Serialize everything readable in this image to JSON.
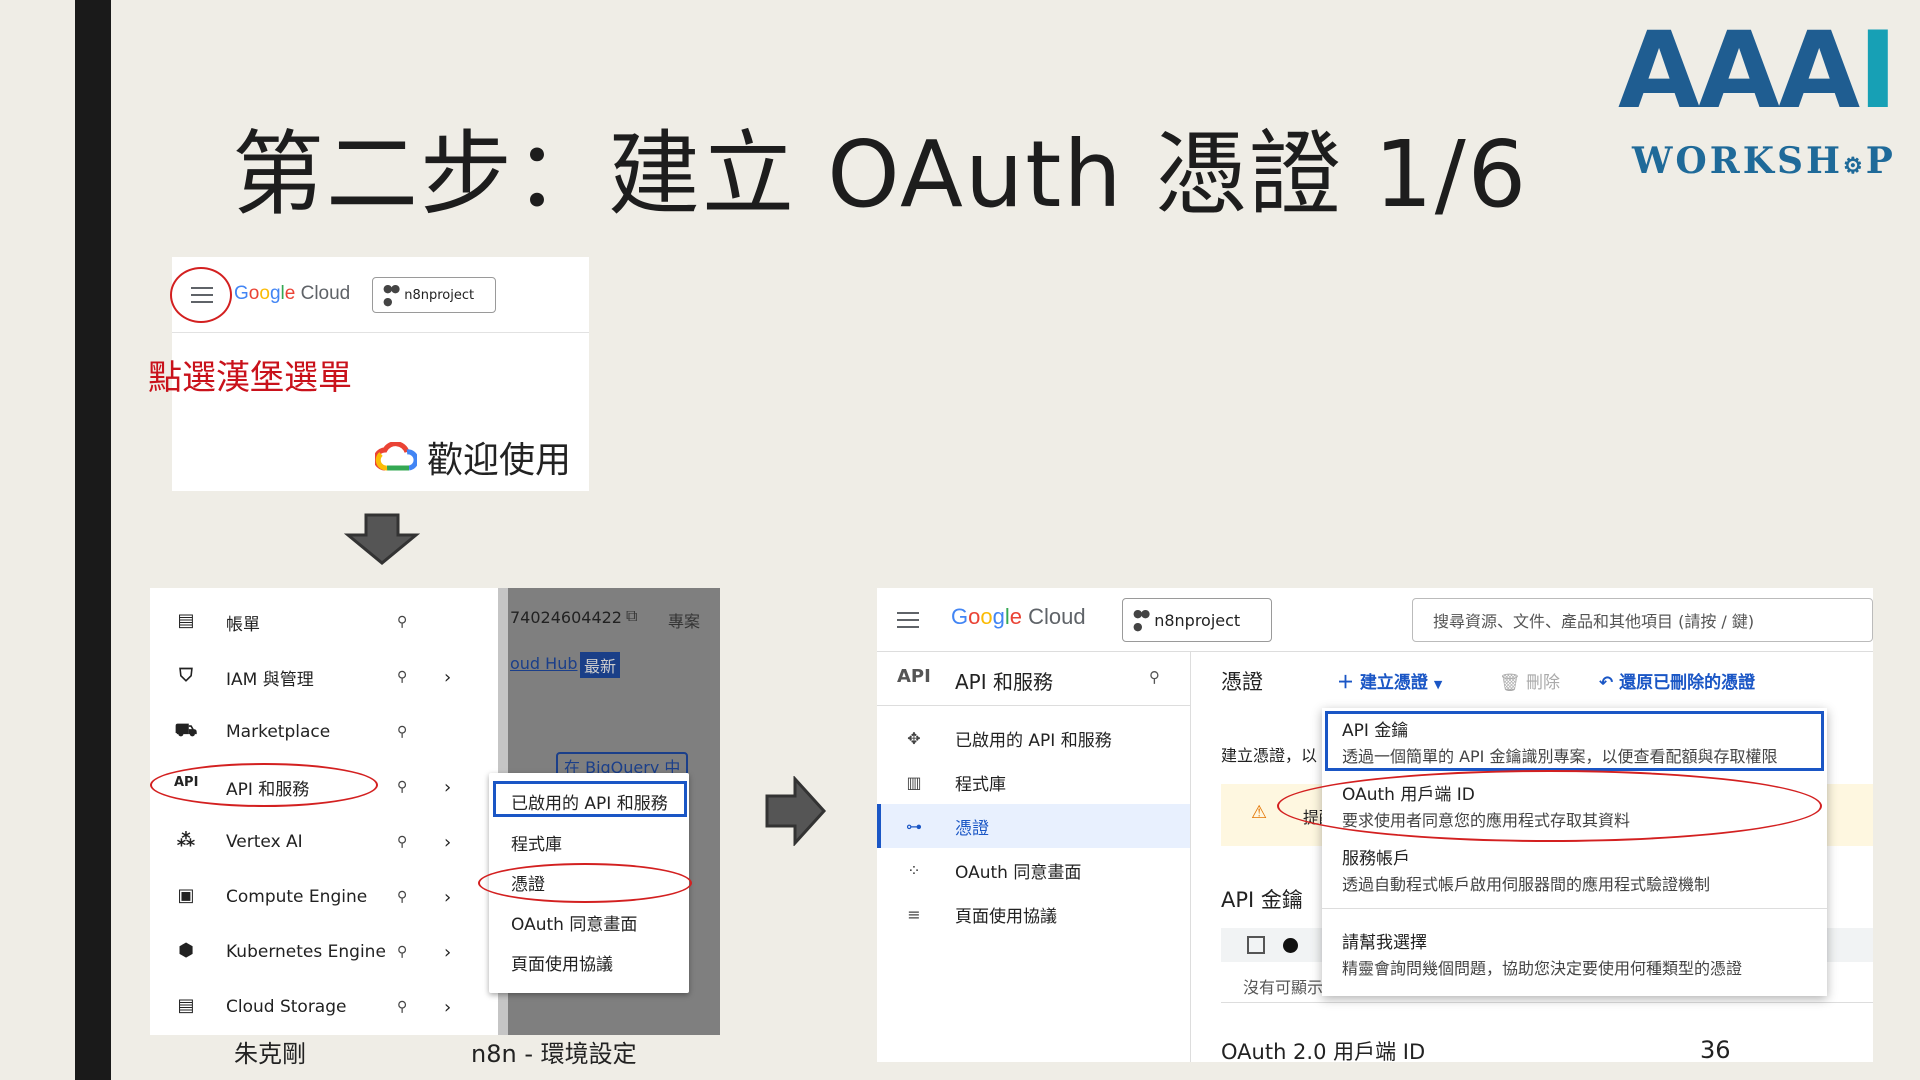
{
  "slide": {
    "title": "第二步：建立 OAuth 憑證 1/6",
    "logo_main": "AAA",
    "logo_main_last": "I",
    "logo_sub": "WORKSH",
    "logo_sub_end": "P",
    "footer_author": "朱克剛",
    "footer_topic": "n8n - 環境設定",
    "page_number": "36"
  },
  "panel1": {
    "brand_google": [
      "G",
      "o",
      "o",
      "g",
      "l",
      "e"
    ],
    "brand_cloud": " Cloud",
    "project": "n8nproject",
    "note": "點選漢堡選單",
    "welcome": "歡迎使用"
  },
  "panel2": {
    "menu": [
      {
        "label": "帳單",
        "icon": "billing-icon",
        "glyph": "▤",
        "chevron": false
      },
      {
        "label": "IAM 與管理",
        "icon": "shield-icon",
        "glyph": "⛉",
        "chevron": true
      },
      {
        "label": "Marketplace",
        "icon": "cart-icon",
        "glyph": "🛒",
        "chevron": false
      },
      {
        "label": "API 和服務",
        "icon": "api-icon",
        "glyph": "API",
        "chevron": true
      },
      {
        "label": "Vertex AI",
        "icon": "vertex-icon",
        "glyph": "⋮",
        "chevron": true
      },
      {
        "label": "Compute Engine",
        "icon": "chip-icon",
        "glyph": "▣",
        "chevron": true
      },
      {
        "label": "Kubernetes Engine",
        "icon": "kubernetes-icon",
        "glyph": "⬢",
        "chevron": true
      },
      {
        "label": "Cloud Storage",
        "icon": "storage-icon",
        "glyph": "▤",
        "chevron": true
      }
    ],
    "bg_project_number": "74024604422",
    "bg_project_label": "專案",
    "bg_hub": "oud Hub",
    "bg_new_badge": "最新",
    "bg_bigquery": "在 BigQuery 中",
    "submenu": [
      "已啟用的 API 和服務",
      "程式庫",
      "憑證",
      "OAuth 同意畫面",
      "頁面使用協議"
    ]
  },
  "panel3": {
    "brand_cloud": " Cloud",
    "project": "n8nproject",
    "search_placeholder": "搜尋資源、文件、產品和其他項目 (請按 / 鍵)",
    "section_icon": "API",
    "section_title": "API 和服務",
    "nav": [
      {
        "label": "已啟用的 API 和服務",
        "icon": "enabled-apis-icon",
        "glyph": "✥"
      },
      {
        "label": "程式庫",
        "icon": "library-icon",
        "glyph": "▥"
      },
      {
        "label": "憑證",
        "icon": "key-icon",
        "glyph": "⊶"
      },
      {
        "label": "OAuth 同意畫面",
        "icon": "consent-icon",
        "glyph": "⁘"
      },
      {
        "label": "頁面使用協議",
        "icon": "settings-list-icon",
        "glyph": "≡"
      }
    ],
    "page_title": "憑證",
    "create_button": "建立憑證",
    "delete_button": "刪除",
    "restore_button": "還原已刪除的憑證",
    "create_hint": "建立憑證，以",
    "warn_text": "提醒",
    "api_keys_heading": "API 金鑰",
    "no_display": "沒有可顯示",
    "oauth_heading": "OAuth 2.0 用戶端 ID",
    "dropdown": [
      {
        "title": "API 金鑰",
        "desc": "透過一個簡單的 API 金鑰識別專案，以便查看配額與存取權限"
      },
      {
        "title": "OAuth 用戶端 ID",
        "desc": "要求使用者同意您的應用程式存取其資料"
      },
      {
        "title": "服務帳戶",
        "desc": "透過自動程式帳戶啟用伺服器間的應用程式驗證機制"
      },
      {
        "title": "請幫我選擇",
        "desc": "精靈會詢問幾個問題，協助您決定要使用何種類型的憑證"
      }
    ]
  },
  "colors": {
    "accent_blue": "#1a56c5",
    "annotation_red": "#d32020",
    "logo_blue": "#1f5d91",
    "logo_teal": "#17a0b5"
  }
}
